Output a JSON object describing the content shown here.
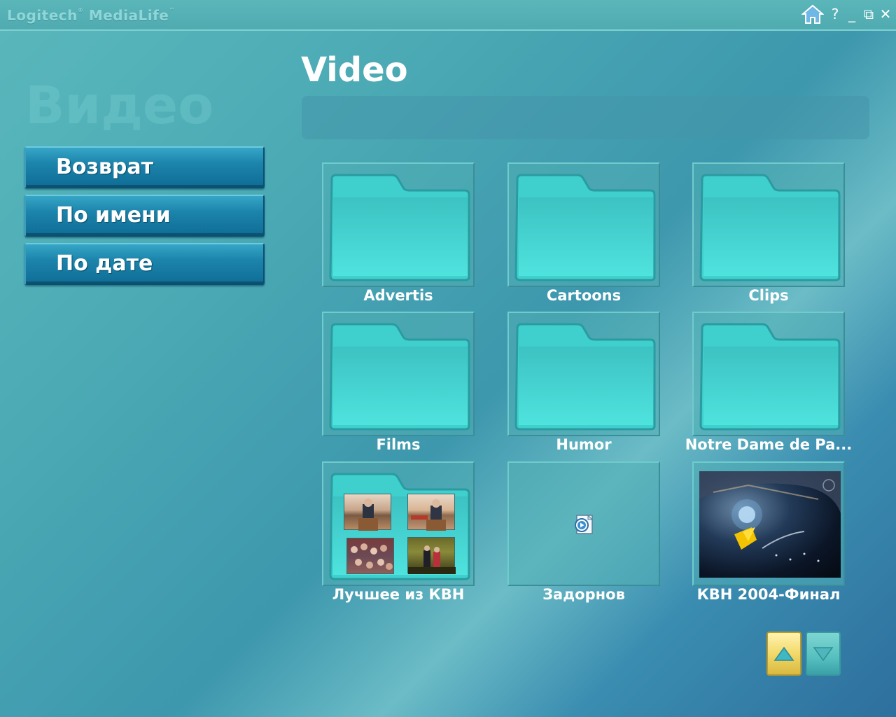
{
  "app": {
    "brand": "Logitech",
    "brand_product": "MediaLife",
    "brand_reg": "®",
    "brand_tm": "™"
  },
  "window_controls": {
    "help_label": "?",
    "minimize_label": "_",
    "restore_label": "⧉",
    "close_label": "✕"
  },
  "watermark": "Видео",
  "sidebar": {
    "items": [
      {
        "label": "Возврат"
      },
      {
        "label": "По имени"
      },
      {
        "label": "По дате"
      }
    ]
  },
  "main": {
    "title": "Video",
    "path": "",
    "items": [
      {
        "label": "Advertis",
        "type": "folder"
      },
      {
        "label": "Cartoons",
        "type": "folder"
      },
      {
        "label": "Clips",
        "type": "folder"
      },
      {
        "label": "Films",
        "type": "folder"
      },
      {
        "label": "Humor",
        "type": "folder"
      },
      {
        "label": "Notre Dame de Pa...",
        "type": "folder"
      },
      {
        "label": "Лучшее из КВН",
        "type": "folder-with-thumbnails"
      },
      {
        "label": "Задорнов",
        "type": "video-file"
      },
      {
        "label": "КВН 2004-Финал",
        "type": "video-thumbnail"
      }
    ]
  },
  "colors": {
    "accent_blue": "#1c84ab",
    "folder_fill": "#4fd6d4",
    "scroll_up_active": "#f3d96a",
    "scroll_down": "#56bfbf"
  },
  "scroll": {
    "up_icon": "triangle-up-icon",
    "down_icon": "triangle-down-icon"
  }
}
